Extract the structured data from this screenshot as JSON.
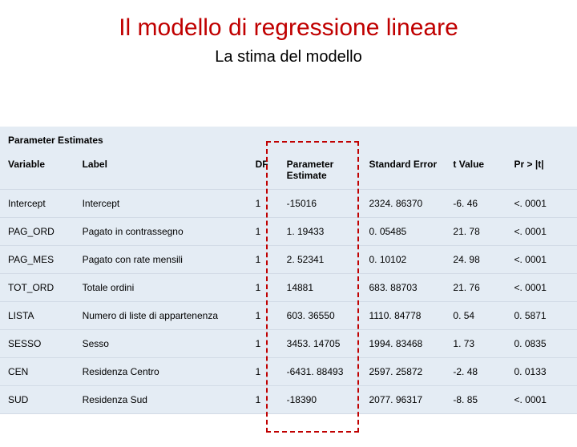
{
  "title": "Il modello di regressione lineare",
  "subtitle": "La stima del modello",
  "table": {
    "section": "Parameter Estimates",
    "headers": {
      "variable": "Variable",
      "label": "Label",
      "df": "DF",
      "pe": "Parameter Estimate",
      "se": "Standard Error",
      "t": "t Value",
      "p": "Pr > |t|"
    },
    "rows": [
      {
        "variable": "Intercept",
        "label": "Intercept",
        "df": "1",
        "pe": "-15016",
        "se": "2324. 86370",
        "t": "-6. 46",
        "p": "<. 0001"
      },
      {
        "variable": "PAG_ORD",
        "label": "Pagato in contrassegno",
        "df": "1",
        "pe": "1. 19433",
        "se": "0. 05485",
        "t": "21. 78",
        "p": "<. 0001"
      },
      {
        "variable": "PAG_MES",
        "label": "Pagato con rate mensili",
        "df": "1",
        "pe": "2. 52341",
        "se": "0. 10102",
        "t": "24. 98",
        "p": "<. 0001"
      },
      {
        "variable": "TOT_ORD",
        "label": "Totale ordini",
        "df": "1",
        "pe": "14881",
        "se": "683. 88703",
        "t": "21. 76",
        "p": "<. 0001"
      },
      {
        "variable": "LISTA",
        "label": "Numero di liste di appartenenza",
        "df": "1",
        "pe": "603. 36550",
        "se": "1110. 84778",
        "t": "0. 54",
        "p": "0. 5871"
      },
      {
        "variable": "SESSO",
        "label": "Sesso",
        "df": "1",
        "pe": "3453. 14705",
        "se": "1994. 83468",
        "t": "1. 73",
        "p": "0. 0835"
      },
      {
        "variable": "CEN",
        "label": "Residenza Centro",
        "df": "1",
        "pe": "-6431. 88493",
        "se": "2597. 25872",
        "t": "-2. 48",
        "p": "0. 0133"
      },
      {
        "variable": "SUD",
        "label": "Residenza Sud",
        "df": "1",
        "pe": "-18390",
        "se": "2077. 96317",
        "t": "-8. 85",
        "p": "<. 0001"
      }
    ]
  }
}
